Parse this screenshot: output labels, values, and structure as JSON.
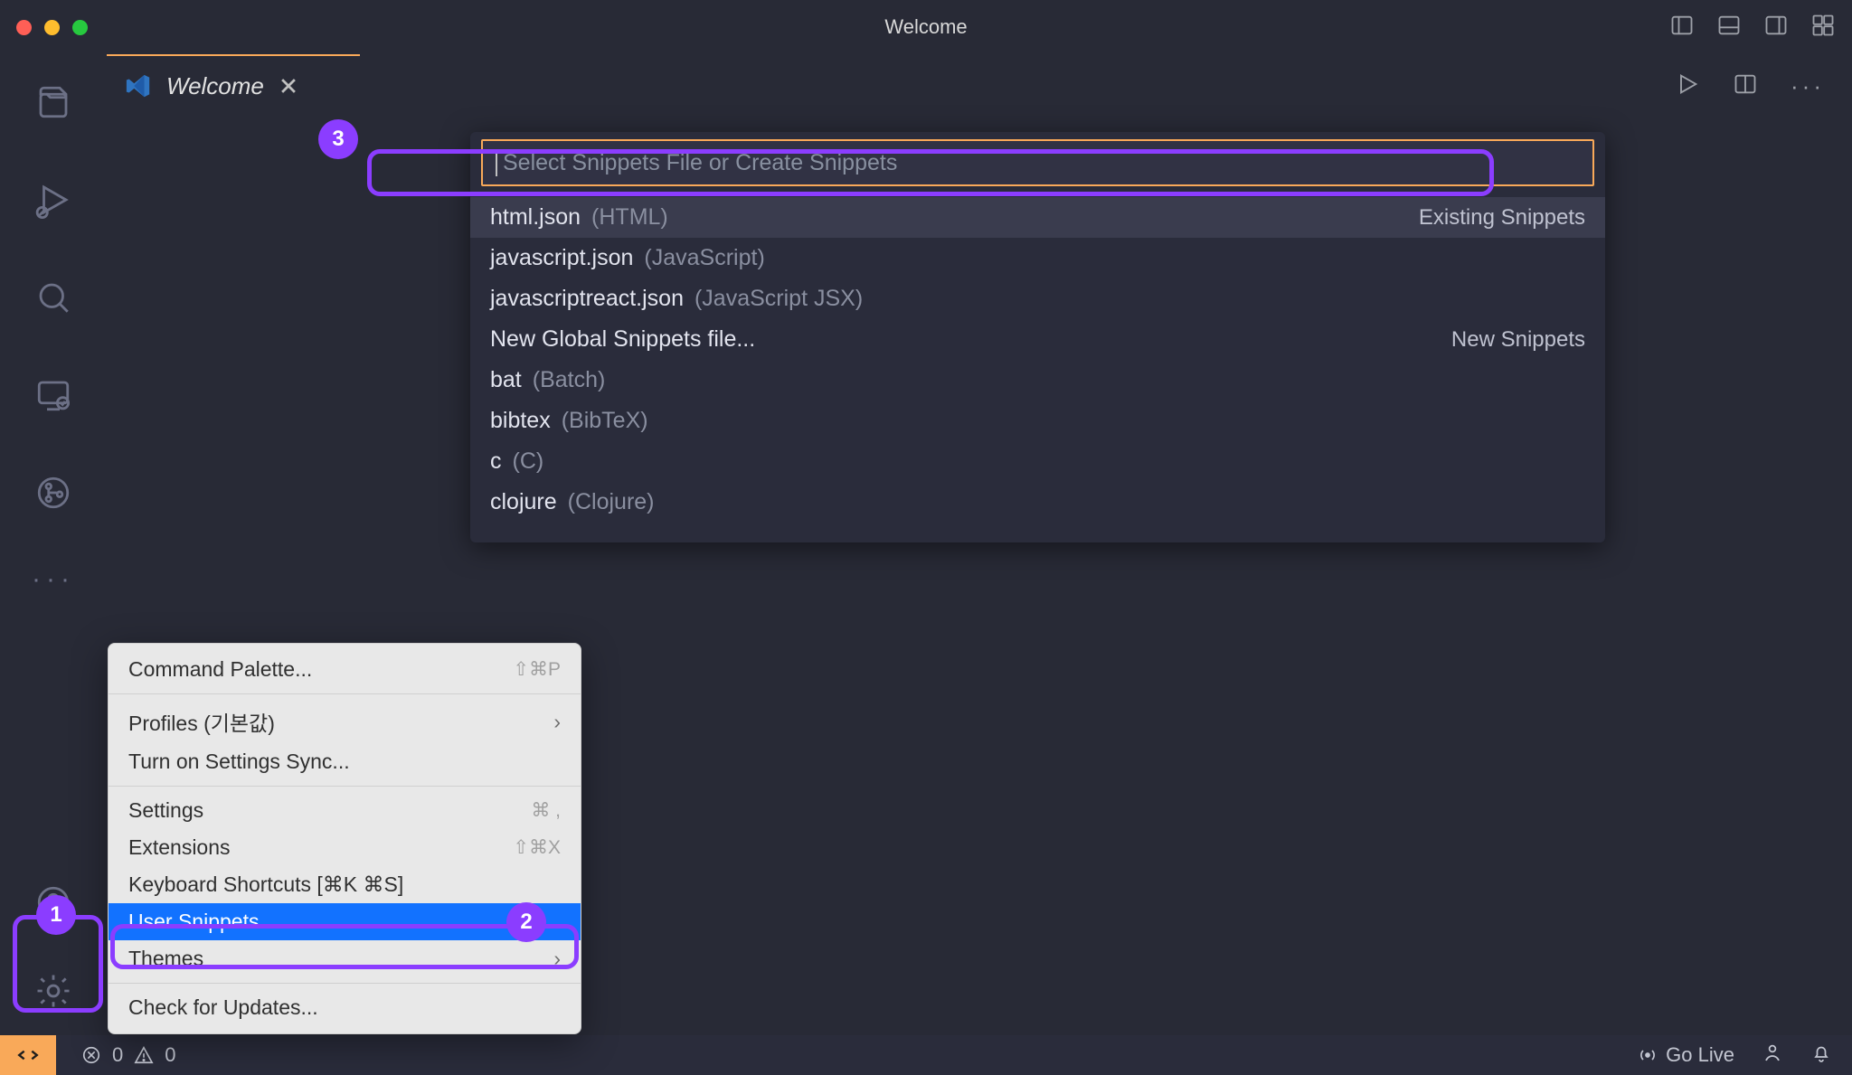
{
  "window": {
    "title": "Welcome"
  },
  "tab": {
    "label": "Welcome"
  },
  "quickpick": {
    "placeholder": "Select Snippets File or Create Snippets",
    "group1_label": "Existing Snippets",
    "group2_label": "New Snippets",
    "items": [
      {
        "name": "html.json",
        "detail": "(HTML)",
        "right": "Existing Snippets",
        "hovered": true
      },
      {
        "name": "javascript.json",
        "detail": "(JavaScript)"
      },
      {
        "name": "javascriptreact.json",
        "detail": "(JavaScript JSX)"
      },
      {
        "name": "New Global Snippets file...",
        "detail": "",
        "right": "New Snippets"
      },
      {
        "name": "bat",
        "detail": "(Batch)"
      },
      {
        "name": "bibtex",
        "detail": "(BibTeX)"
      },
      {
        "name": "c",
        "detail": "(C)"
      },
      {
        "name": "clojure",
        "detail": "(Clojure)"
      }
    ]
  },
  "context_menu": {
    "items": [
      {
        "label": "Command Palette...",
        "shortcut": "⇧⌘P"
      },
      {
        "sep": true
      },
      {
        "label": "Profiles (기본값)",
        "submenu": true
      },
      {
        "label": "Turn on Settings Sync..."
      },
      {
        "sep": true
      },
      {
        "label": "Settings",
        "shortcut": "⌘ ,"
      },
      {
        "label": "Extensions",
        "shortcut": "⇧⌘X"
      },
      {
        "label": "Keyboard Shortcuts [⌘K ⌘S]"
      },
      {
        "label": "User Snippets",
        "selected": true
      },
      {
        "label": "Themes",
        "submenu": true
      },
      {
        "sep": true
      },
      {
        "label": "Check for Updates..."
      }
    ]
  },
  "statusbar": {
    "errors": "0",
    "warnings": "0",
    "golive": "Go Live"
  },
  "annotations": {
    "b1": "1",
    "b2": "2",
    "b3": "3"
  }
}
